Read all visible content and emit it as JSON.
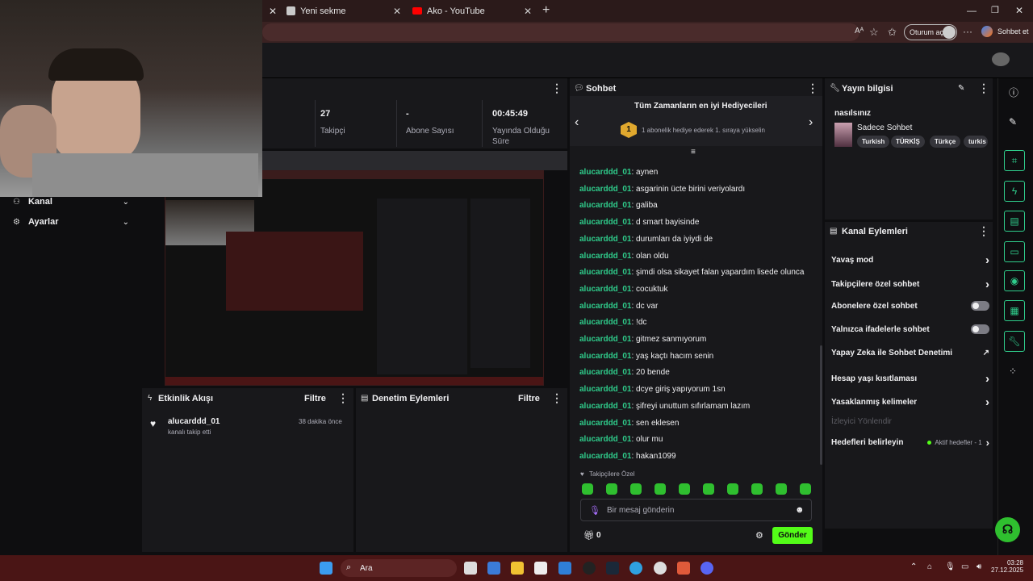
{
  "browser": {
    "tabs": [
      {
        "label": "Yeni sekme"
      },
      {
        "label": "Ako - YouTube"
      }
    ],
    "new_tab": "+",
    "session_label": "Oturum aç",
    "copilot_label": "Sohbet et"
  },
  "sidebar": {
    "items": [
      {
        "label": "Kanal"
      },
      {
        "label": "Ayarlar"
      }
    ]
  },
  "stats": [
    {
      "value": "27",
      "label": "Takipçi"
    },
    {
      "value": "-",
      "label": "Abone Sayısı"
    },
    {
      "value": "00:45:49",
      "label": "Yayında Olduğu Süre"
    }
  ],
  "activity": {
    "title": "Etkinlik Akışı",
    "filter": "Filtre",
    "items": [
      {
        "user": "alucarddd_01",
        "text": "kanalı takip etti",
        "time": "38 dakika önce"
      }
    ]
  },
  "moderation": {
    "title": "Denetim Eylemleri",
    "filter": "Filtre"
  },
  "chat": {
    "title": "Sohbet",
    "gifters_title": "Tüm Zamanların en iyi Hediyecileri",
    "gifters_rank": "1",
    "gifters_text": "1 abonelik hediye ederek 1. sıraya yükselin",
    "messages": [
      {
        "user": "alucarddd_01",
        "text": "aynen"
      },
      {
        "user": "alucarddd_01",
        "text": "asgarinin ücte birini veriyolardı"
      },
      {
        "user": "alucarddd_01",
        "text": "galiba"
      },
      {
        "user": "alucarddd_01",
        "text": "d smart bayisinde"
      },
      {
        "user": "alucarddd_01",
        "text": "durumları da iyiydi de"
      },
      {
        "user": "alucarddd_01",
        "text": "olan oldu"
      },
      {
        "user": "alucarddd_01",
        "text": "şimdi olsa sikayet falan yapardım lisede olunca"
      },
      {
        "user": "alucarddd_01",
        "text": "cocuktuk"
      },
      {
        "user": "alucarddd_01",
        "text": "dc var"
      },
      {
        "user": "alucarddd_01",
        "text": "!dc"
      },
      {
        "user": "alucarddd_01",
        "text": "gitmez sanmıyorum"
      },
      {
        "user": "alucarddd_01",
        "text": "yaş kaçtı hacım senin"
      },
      {
        "user": "alucarddd_01",
        "text": "20 bende"
      },
      {
        "user": "alucarddd_01",
        "text": "dcye giriş yapıyorum 1sn"
      },
      {
        "user": "alucarddd_01",
        "text": "şifreyi unuttum sıfırlamam lazım"
      },
      {
        "user": "alucarddd_01",
        "text": "sen eklesen"
      },
      {
        "user": "alucarddd_01",
        "text": "olur mu"
      },
      {
        "user": "alucarddd_01",
        "text": "hakan1099"
      }
    ],
    "followers_only_label": "Takipçilere Özel",
    "input_placeholder": "Bir mesaj gönderin",
    "points": "0",
    "send_label": "Gönder"
  },
  "stream_info": {
    "title": "Yayın bilgisi",
    "stream_title": "nasılsınız",
    "category": "Sadece Sohbet",
    "tags": [
      "Turkish",
      "TÜRKİŞ",
      "Türkçe",
      "turkis"
    ]
  },
  "channel_actions": {
    "title": "Kanal Eylemleri",
    "items": [
      {
        "label": "Yavaş mod",
        "control": "chevron"
      },
      {
        "label": "Takipçilere özel sohbet",
        "control": "chevron"
      },
      {
        "label": "Abonelere özel sohbet",
        "control": "toggle"
      },
      {
        "label": "Yalnızca ifadelerle sohbet",
        "control": "toggle"
      },
      {
        "label": "Yapay Zeka ile Sohbet Denetimi",
        "control": "external"
      },
      {
        "label": "Hesap yaşı kısıtlaması",
        "control": "chevron"
      },
      {
        "label": "Yasaklanmış kelimeler",
        "control": "chevron"
      }
    ],
    "viewer_director": "İzleyici Yönlendir",
    "goals_label": "Hedefleri belirleyin",
    "goals_status": "Aktif hedefler - 1"
  },
  "taskbar": {
    "search_label": "Ara",
    "time": "03:28",
    "date": "27.12.2025"
  },
  "colors": {
    "accent": "#53fc18",
    "chat_user": "#2fcc8b",
    "panel": "#18181b",
    "background": "#0e0e10",
    "taskbar": "#4a1515"
  }
}
